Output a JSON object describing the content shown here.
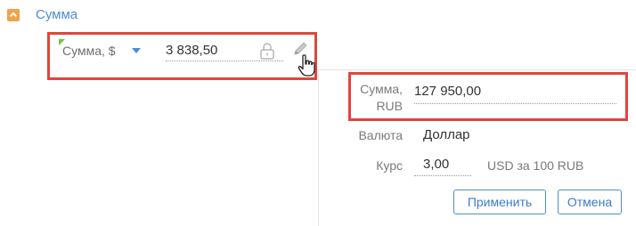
{
  "section": {
    "title": "Сумма",
    "collapse_icon": "chevron-up-icon"
  },
  "amount_row": {
    "currency_label": "Сумма, $",
    "amount_value": "3 838,50",
    "lock_icon": "lock-icon",
    "edit_icon": "pencil-icon"
  },
  "popup": {
    "total_label_line1": "Сумма,",
    "total_label_line2": "RUB",
    "total_value": "127 950,00",
    "currency_label": "Валюта",
    "currency_value": "Доллар",
    "rate_label": "Курс",
    "rate_value": "3,00",
    "rate_suffix": "USD за 100 RUB",
    "apply_label": "Применить",
    "cancel_label": "Отмена"
  },
  "colors": {
    "accent": "#4c8bd6",
    "highlight": "#e0453c",
    "collapse": "#f0a34a",
    "marker": "#7bbf3a"
  }
}
